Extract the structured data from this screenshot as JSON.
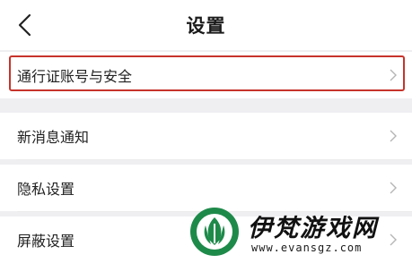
{
  "header": {
    "title": "设置",
    "back_icon": "chevron-left-icon"
  },
  "settings": {
    "items": [
      {
        "label": "通行证账号与安全",
        "icon": "chevron-right-icon",
        "highlighted": true
      },
      {
        "label": "新消息通知",
        "icon": "chevron-right-icon"
      },
      {
        "label": "隐私设置",
        "icon": "chevron-right-icon"
      },
      {
        "label": "屏蔽设置",
        "icon": "chevron-right-icon"
      }
    ]
  },
  "watermark": {
    "name": "伊梵游戏网",
    "url": "www.evansgz.com",
    "accent": "#1e8a4a"
  },
  "colors": {
    "highlight_border": "#c7332b",
    "background": "#efeff2"
  }
}
